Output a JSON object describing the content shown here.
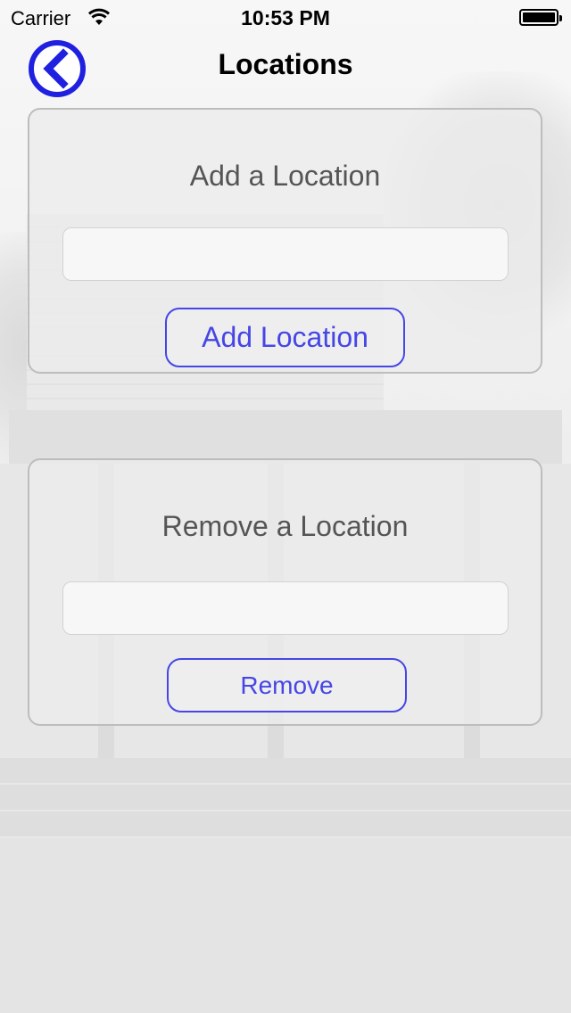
{
  "status_bar": {
    "carrier": "Carrier",
    "time": "10:53 PM",
    "wifi_icon": "wifi-icon",
    "battery_icon": "battery-icon",
    "battery_level": 1.0
  },
  "nav": {
    "title": "Locations",
    "back_icon": "back-chevron-icon"
  },
  "add_section": {
    "heading": "Add a Location",
    "input_value": "",
    "input_placeholder": "",
    "button_label": "Add Location"
  },
  "remove_section": {
    "heading": "Remove a Location",
    "input_value": "",
    "input_placeholder": "",
    "button_label": "Remove"
  },
  "colors": {
    "accent": "#4646e6",
    "back_button": "#2020e0",
    "heading_text": "#555555",
    "panel_border": "#bdbdbd"
  }
}
